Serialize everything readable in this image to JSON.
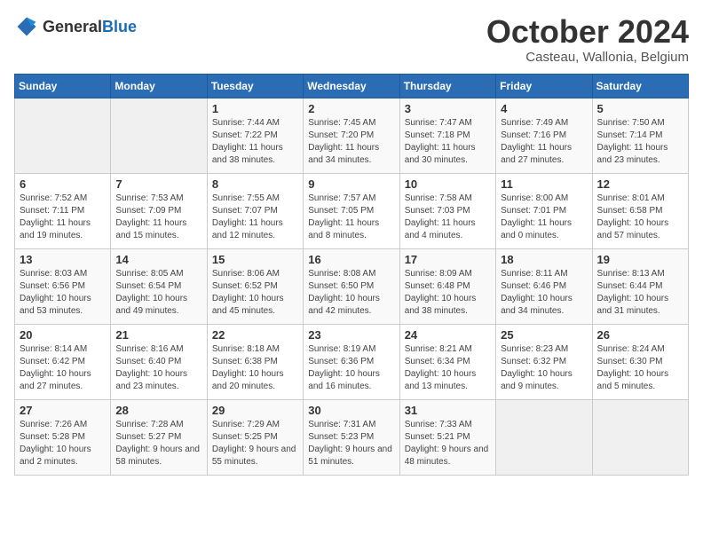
{
  "logo": {
    "general": "General",
    "blue": "Blue"
  },
  "title": "October 2024",
  "location": "Casteau, Wallonia, Belgium",
  "weekdays": [
    "Sunday",
    "Monday",
    "Tuesday",
    "Wednesday",
    "Thursday",
    "Friday",
    "Saturday"
  ],
  "weeks": [
    [
      {
        "day": "",
        "sunrise": "",
        "sunset": "",
        "daylight": ""
      },
      {
        "day": "",
        "sunrise": "",
        "sunset": "",
        "daylight": ""
      },
      {
        "day": "1",
        "sunrise": "Sunrise: 7:44 AM",
        "sunset": "Sunset: 7:22 PM",
        "daylight": "Daylight: 11 hours and 38 minutes."
      },
      {
        "day": "2",
        "sunrise": "Sunrise: 7:45 AM",
        "sunset": "Sunset: 7:20 PM",
        "daylight": "Daylight: 11 hours and 34 minutes."
      },
      {
        "day": "3",
        "sunrise": "Sunrise: 7:47 AM",
        "sunset": "Sunset: 7:18 PM",
        "daylight": "Daylight: 11 hours and 30 minutes."
      },
      {
        "day": "4",
        "sunrise": "Sunrise: 7:49 AM",
        "sunset": "Sunset: 7:16 PM",
        "daylight": "Daylight: 11 hours and 27 minutes."
      },
      {
        "day": "5",
        "sunrise": "Sunrise: 7:50 AM",
        "sunset": "Sunset: 7:14 PM",
        "daylight": "Daylight: 11 hours and 23 minutes."
      }
    ],
    [
      {
        "day": "6",
        "sunrise": "Sunrise: 7:52 AM",
        "sunset": "Sunset: 7:11 PM",
        "daylight": "Daylight: 11 hours and 19 minutes."
      },
      {
        "day": "7",
        "sunrise": "Sunrise: 7:53 AM",
        "sunset": "Sunset: 7:09 PM",
        "daylight": "Daylight: 11 hours and 15 minutes."
      },
      {
        "day": "8",
        "sunrise": "Sunrise: 7:55 AM",
        "sunset": "Sunset: 7:07 PM",
        "daylight": "Daylight: 11 hours and 12 minutes."
      },
      {
        "day": "9",
        "sunrise": "Sunrise: 7:57 AM",
        "sunset": "Sunset: 7:05 PM",
        "daylight": "Daylight: 11 hours and 8 minutes."
      },
      {
        "day": "10",
        "sunrise": "Sunrise: 7:58 AM",
        "sunset": "Sunset: 7:03 PM",
        "daylight": "Daylight: 11 hours and 4 minutes."
      },
      {
        "day": "11",
        "sunrise": "Sunrise: 8:00 AM",
        "sunset": "Sunset: 7:01 PM",
        "daylight": "Daylight: 11 hours and 0 minutes."
      },
      {
        "day": "12",
        "sunrise": "Sunrise: 8:01 AM",
        "sunset": "Sunset: 6:58 PM",
        "daylight": "Daylight: 10 hours and 57 minutes."
      }
    ],
    [
      {
        "day": "13",
        "sunrise": "Sunrise: 8:03 AM",
        "sunset": "Sunset: 6:56 PM",
        "daylight": "Daylight: 10 hours and 53 minutes."
      },
      {
        "day": "14",
        "sunrise": "Sunrise: 8:05 AM",
        "sunset": "Sunset: 6:54 PM",
        "daylight": "Daylight: 10 hours and 49 minutes."
      },
      {
        "day": "15",
        "sunrise": "Sunrise: 8:06 AM",
        "sunset": "Sunset: 6:52 PM",
        "daylight": "Daylight: 10 hours and 45 minutes."
      },
      {
        "day": "16",
        "sunrise": "Sunrise: 8:08 AM",
        "sunset": "Sunset: 6:50 PM",
        "daylight": "Daylight: 10 hours and 42 minutes."
      },
      {
        "day": "17",
        "sunrise": "Sunrise: 8:09 AM",
        "sunset": "Sunset: 6:48 PM",
        "daylight": "Daylight: 10 hours and 38 minutes."
      },
      {
        "day": "18",
        "sunrise": "Sunrise: 8:11 AM",
        "sunset": "Sunset: 6:46 PM",
        "daylight": "Daylight: 10 hours and 34 minutes."
      },
      {
        "day": "19",
        "sunrise": "Sunrise: 8:13 AM",
        "sunset": "Sunset: 6:44 PM",
        "daylight": "Daylight: 10 hours and 31 minutes."
      }
    ],
    [
      {
        "day": "20",
        "sunrise": "Sunrise: 8:14 AM",
        "sunset": "Sunset: 6:42 PM",
        "daylight": "Daylight: 10 hours and 27 minutes."
      },
      {
        "day": "21",
        "sunrise": "Sunrise: 8:16 AM",
        "sunset": "Sunset: 6:40 PM",
        "daylight": "Daylight: 10 hours and 23 minutes."
      },
      {
        "day": "22",
        "sunrise": "Sunrise: 8:18 AM",
        "sunset": "Sunset: 6:38 PM",
        "daylight": "Daylight: 10 hours and 20 minutes."
      },
      {
        "day": "23",
        "sunrise": "Sunrise: 8:19 AM",
        "sunset": "Sunset: 6:36 PM",
        "daylight": "Daylight: 10 hours and 16 minutes."
      },
      {
        "day": "24",
        "sunrise": "Sunrise: 8:21 AM",
        "sunset": "Sunset: 6:34 PM",
        "daylight": "Daylight: 10 hours and 13 minutes."
      },
      {
        "day": "25",
        "sunrise": "Sunrise: 8:23 AM",
        "sunset": "Sunset: 6:32 PM",
        "daylight": "Daylight: 10 hours and 9 minutes."
      },
      {
        "day": "26",
        "sunrise": "Sunrise: 8:24 AM",
        "sunset": "Sunset: 6:30 PM",
        "daylight": "Daylight: 10 hours and 5 minutes."
      }
    ],
    [
      {
        "day": "27",
        "sunrise": "Sunrise: 7:26 AM",
        "sunset": "Sunset: 5:28 PM",
        "daylight": "Daylight: 10 hours and 2 minutes."
      },
      {
        "day": "28",
        "sunrise": "Sunrise: 7:28 AM",
        "sunset": "Sunset: 5:27 PM",
        "daylight": "Daylight: 9 hours and 58 minutes."
      },
      {
        "day": "29",
        "sunrise": "Sunrise: 7:29 AM",
        "sunset": "Sunset: 5:25 PM",
        "daylight": "Daylight: 9 hours and 55 minutes."
      },
      {
        "day": "30",
        "sunrise": "Sunrise: 7:31 AM",
        "sunset": "Sunset: 5:23 PM",
        "daylight": "Daylight: 9 hours and 51 minutes."
      },
      {
        "day": "31",
        "sunrise": "Sunrise: 7:33 AM",
        "sunset": "Sunset: 5:21 PM",
        "daylight": "Daylight: 9 hours and 48 minutes."
      },
      {
        "day": "",
        "sunrise": "",
        "sunset": "",
        "daylight": ""
      },
      {
        "day": "",
        "sunrise": "",
        "sunset": "",
        "daylight": ""
      }
    ]
  ]
}
